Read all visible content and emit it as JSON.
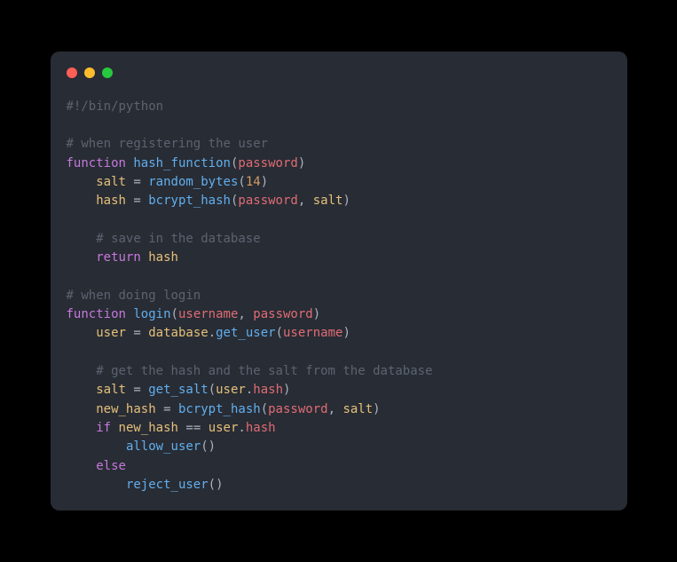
{
  "code": {
    "lines": [
      {
        "indent": 0,
        "tokens": [
          {
            "cls": "comment",
            "t": "#!/bin/python"
          }
        ]
      },
      {
        "indent": 0,
        "tokens": []
      },
      {
        "indent": 0,
        "tokens": [
          {
            "cls": "comment",
            "t": "# when registering the user"
          }
        ]
      },
      {
        "indent": 0,
        "tokens": [
          {
            "cls": "keyword",
            "t": "function"
          },
          {
            "cls": "",
            "t": " "
          },
          {
            "cls": "funcname",
            "t": "hash_function"
          },
          {
            "cls": "punct",
            "t": "("
          },
          {
            "cls": "param",
            "t": "password"
          },
          {
            "cls": "punct",
            "t": ")"
          }
        ]
      },
      {
        "indent": 1,
        "tokens": [
          {
            "cls": "variable",
            "t": "salt"
          },
          {
            "cls": "",
            "t": " "
          },
          {
            "cls": "punct",
            "t": "="
          },
          {
            "cls": "",
            "t": " "
          },
          {
            "cls": "call",
            "t": "random_bytes"
          },
          {
            "cls": "punct",
            "t": "("
          },
          {
            "cls": "number",
            "t": "14"
          },
          {
            "cls": "punct",
            "t": ")"
          }
        ]
      },
      {
        "indent": 1,
        "tokens": [
          {
            "cls": "variable",
            "t": "hash"
          },
          {
            "cls": "",
            "t": " "
          },
          {
            "cls": "punct",
            "t": "="
          },
          {
            "cls": "",
            "t": " "
          },
          {
            "cls": "call",
            "t": "bcrypt_hash"
          },
          {
            "cls": "punct",
            "t": "("
          },
          {
            "cls": "param",
            "t": "password"
          },
          {
            "cls": "punct",
            "t": ","
          },
          {
            "cls": "",
            "t": " "
          },
          {
            "cls": "variable",
            "t": "salt"
          },
          {
            "cls": "punct",
            "t": ")"
          }
        ]
      },
      {
        "indent": 0,
        "tokens": []
      },
      {
        "indent": 1,
        "tokens": [
          {
            "cls": "comment",
            "t": "# save in the database"
          }
        ]
      },
      {
        "indent": 1,
        "tokens": [
          {
            "cls": "keyword",
            "t": "return"
          },
          {
            "cls": "",
            "t": " "
          },
          {
            "cls": "variable",
            "t": "hash"
          }
        ]
      },
      {
        "indent": 0,
        "tokens": []
      },
      {
        "indent": 0,
        "tokens": [
          {
            "cls": "comment",
            "t": "# when doing login"
          }
        ]
      },
      {
        "indent": 0,
        "tokens": [
          {
            "cls": "keyword",
            "t": "function"
          },
          {
            "cls": "",
            "t": " "
          },
          {
            "cls": "funcname",
            "t": "login"
          },
          {
            "cls": "punct",
            "t": "("
          },
          {
            "cls": "param",
            "t": "username"
          },
          {
            "cls": "punct",
            "t": ","
          },
          {
            "cls": "",
            "t": " "
          },
          {
            "cls": "param",
            "t": "password"
          },
          {
            "cls": "punct",
            "t": ")"
          }
        ]
      },
      {
        "indent": 1,
        "tokens": [
          {
            "cls": "variable",
            "t": "user"
          },
          {
            "cls": "",
            "t": " "
          },
          {
            "cls": "punct",
            "t": "="
          },
          {
            "cls": "",
            "t": " "
          },
          {
            "cls": "variable",
            "t": "database"
          },
          {
            "cls": "punct",
            "t": "."
          },
          {
            "cls": "call",
            "t": "get_user"
          },
          {
            "cls": "punct",
            "t": "("
          },
          {
            "cls": "param",
            "t": "username"
          },
          {
            "cls": "punct",
            "t": ")"
          }
        ]
      },
      {
        "indent": 0,
        "tokens": []
      },
      {
        "indent": 1,
        "tokens": [
          {
            "cls": "comment",
            "t": "# get the hash and the salt from the database"
          }
        ]
      },
      {
        "indent": 1,
        "tokens": [
          {
            "cls": "variable",
            "t": "salt"
          },
          {
            "cls": "",
            "t": " "
          },
          {
            "cls": "punct",
            "t": "="
          },
          {
            "cls": "",
            "t": " "
          },
          {
            "cls": "call",
            "t": "get_salt"
          },
          {
            "cls": "punct",
            "t": "("
          },
          {
            "cls": "variable",
            "t": "user"
          },
          {
            "cls": "punct",
            "t": "."
          },
          {
            "cls": "prop",
            "t": "hash"
          },
          {
            "cls": "punct",
            "t": ")"
          }
        ]
      },
      {
        "indent": 1,
        "tokens": [
          {
            "cls": "variable",
            "t": "new_hash"
          },
          {
            "cls": "",
            "t": " "
          },
          {
            "cls": "punct",
            "t": "="
          },
          {
            "cls": "",
            "t": " "
          },
          {
            "cls": "call",
            "t": "bcrypt_hash"
          },
          {
            "cls": "punct",
            "t": "("
          },
          {
            "cls": "param",
            "t": "password"
          },
          {
            "cls": "punct",
            "t": ","
          },
          {
            "cls": "",
            "t": " "
          },
          {
            "cls": "variable",
            "t": "salt"
          },
          {
            "cls": "punct",
            "t": ")"
          }
        ]
      },
      {
        "indent": 1,
        "tokens": [
          {
            "cls": "keyword",
            "t": "if"
          },
          {
            "cls": "",
            "t": " "
          },
          {
            "cls": "variable",
            "t": "new_hash"
          },
          {
            "cls": "",
            "t": " "
          },
          {
            "cls": "punct",
            "t": "=="
          },
          {
            "cls": "",
            "t": " "
          },
          {
            "cls": "variable",
            "t": "user"
          },
          {
            "cls": "punct",
            "t": "."
          },
          {
            "cls": "prop",
            "t": "hash"
          }
        ]
      },
      {
        "indent": 2,
        "tokens": [
          {
            "cls": "call",
            "t": "allow_user"
          },
          {
            "cls": "punct",
            "t": "()"
          }
        ]
      },
      {
        "indent": 1,
        "tokens": [
          {
            "cls": "keyword",
            "t": "else"
          }
        ]
      },
      {
        "indent": 2,
        "tokens": [
          {
            "cls": "call",
            "t": "reject_user"
          },
          {
            "cls": "punct",
            "t": "()"
          }
        ]
      }
    ]
  }
}
